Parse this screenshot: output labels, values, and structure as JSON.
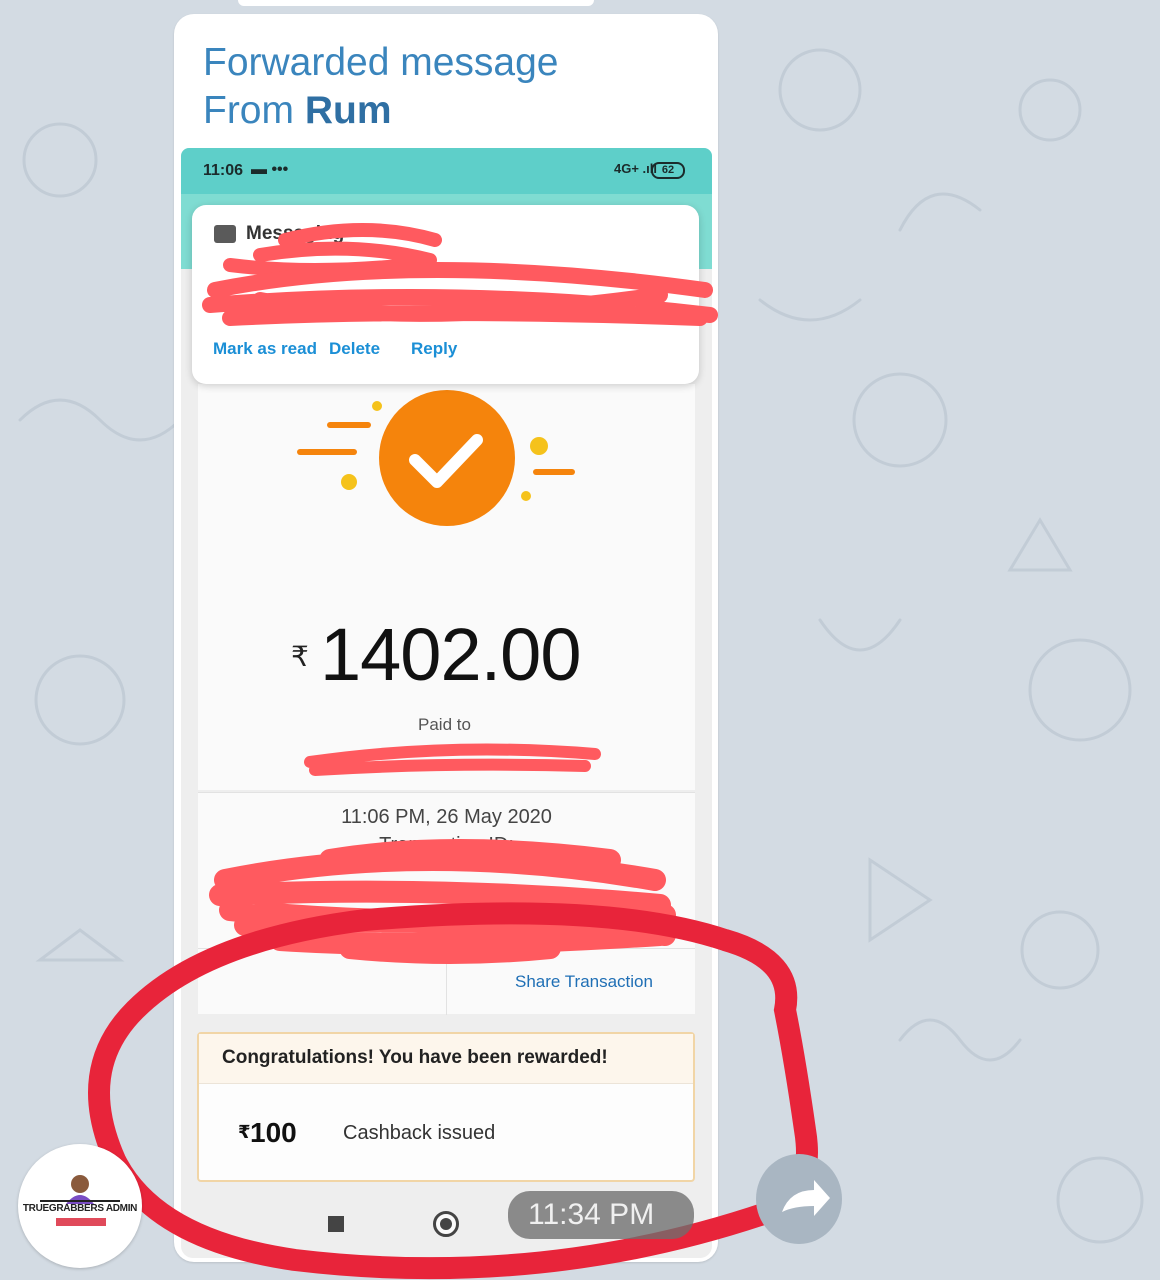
{
  "forwarded": {
    "line1": "Forwarded message",
    "from_prefix": "From ",
    "from_name": "Rum"
  },
  "status_bar": {
    "time": "11:06",
    "signal": "4G+ .ıll",
    "battery": "62"
  },
  "notification": {
    "app": "Messaging",
    "actions": [
      "Mark as read",
      "Delete",
      "Reply"
    ]
  },
  "payment": {
    "currency_symbol": "₹",
    "amount": "1402.00",
    "paid_to_label": "Paid to",
    "datetime": "11:06 PM, 26 May 2020",
    "transaction_label": "Transaction ID:",
    "share_label": "Share Transaction"
  },
  "reward": {
    "title": "Congratulations! You have been rewarded!",
    "currency_symbol": "₹",
    "amount": "100",
    "status": "Cashback issued"
  },
  "message": {
    "time": "11:34 PM"
  },
  "avatar": {
    "name": "TRUEGRABBERS ADMIN"
  },
  "colors": {
    "forward_title": "#3a85bd",
    "status_bar": "#5ecfc9",
    "success_orange": "#f5840c",
    "scribble_red": "#ff5a5f",
    "highlight_red": "#e8243a",
    "chat_background": "#d3dbe3"
  }
}
